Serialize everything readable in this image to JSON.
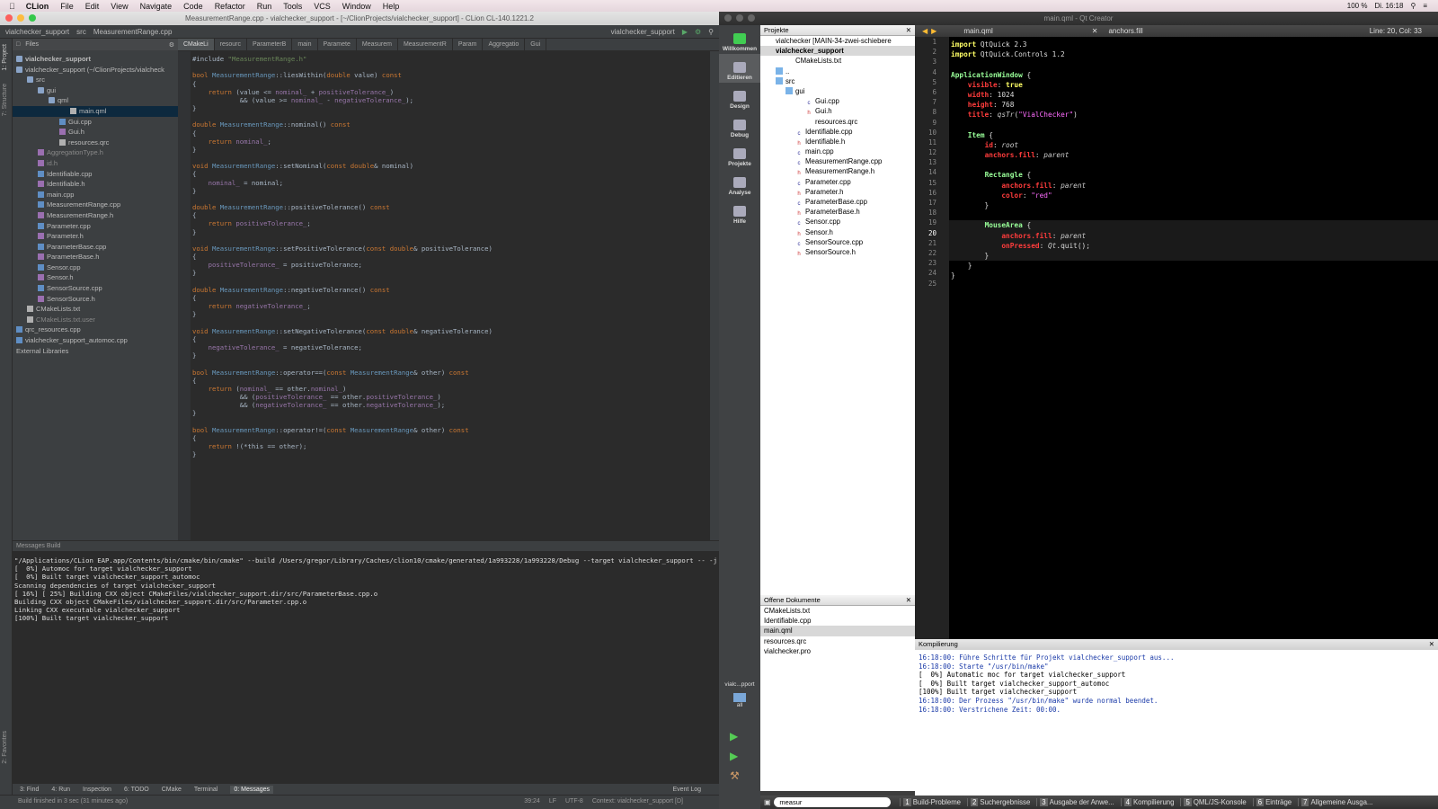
{
  "menubar": {
    "app_name": "CLion",
    "items": [
      "File",
      "Edit",
      "View",
      "Navigate",
      "Code",
      "Refactor",
      "Run",
      "Tools",
      "VCS",
      "Window",
      "Help"
    ],
    "battery": "100 %",
    "clock": "Di. 16:18"
  },
  "clion": {
    "window_title": "MeasurementRange.cpp - vialchecker_support - [~/ClionProjects/vialchecker_support] - CLion CL-140.1221.2",
    "breadcrumb": [
      "vialchecker_support",
      "src",
      "MeasurementRange.cpp"
    ],
    "run_config": "vialchecker_support",
    "project_tab": "Files",
    "tree": [
      {
        "label": "vialchecker_support",
        "indent": 0,
        "kind": "root"
      },
      {
        "label": "vialchecker_support (~/ClionProjects/vialcheck",
        "indent": 0,
        "kind": "folder"
      },
      {
        "label": "src",
        "indent": 1,
        "kind": "folder"
      },
      {
        "label": "gui",
        "indent": 2,
        "kind": "folder"
      },
      {
        "label": "qml",
        "indent": 3,
        "kind": "folder"
      },
      {
        "label": "main.qml",
        "indent": 5,
        "kind": "file",
        "selected": true
      },
      {
        "label": "Gui.cpp",
        "indent": 4,
        "kind": "cpp"
      },
      {
        "label": "Gui.h",
        "indent": 4,
        "kind": "h"
      },
      {
        "label": "resources.qrc",
        "indent": 4,
        "kind": "file"
      },
      {
        "label": "AggregationType.h",
        "indent": 2,
        "kind": "h",
        "dim": true
      },
      {
        "label": "id.h",
        "indent": 2,
        "kind": "h",
        "dim": true
      },
      {
        "label": "Identifiable.cpp",
        "indent": 2,
        "kind": "cpp"
      },
      {
        "label": "Identifiable.h",
        "indent": 2,
        "kind": "h"
      },
      {
        "label": "main.cpp",
        "indent": 2,
        "kind": "cpp"
      },
      {
        "label": "MeasurementRange.cpp",
        "indent": 2,
        "kind": "cpp"
      },
      {
        "label": "MeasurementRange.h",
        "indent": 2,
        "kind": "h"
      },
      {
        "label": "Parameter.cpp",
        "indent": 2,
        "kind": "cpp"
      },
      {
        "label": "Parameter.h",
        "indent": 2,
        "kind": "h"
      },
      {
        "label": "ParameterBase.cpp",
        "indent": 2,
        "kind": "cpp"
      },
      {
        "label": "ParameterBase.h",
        "indent": 2,
        "kind": "h"
      },
      {
        "label": "Sensor.cpp",
        "indent": 2,
        "kind": "cpp"
      },
      {
        "label": "Sensor.h",
        "indent": 2,
        "kind": "h"
      },
      {
        "label": "SensorSource.cpp",
        "indent": 2,
        "kind": "cpp"
      },
      {
        "label": "SensorSource.h",
        "indent": 2,
        "kind": "h"
      },
      {
        "label": "CMakeLists.txt",
        "indent": 1,
        "kind": "txt"
      },
      {
        "label": "CMakeLists.txt.user",
        "indent": 1,
        "kind": "txt",
        "dim": true
      },
      {
        "label": "qrc_resources.cpp",
        "indent": 0,
        "kind": "cpp"
      },
      {
        "label": "vialchecker_support_automoc.cpp",
        "indent": 0,
        "kind": "cpp"
      },
      {
        "label": "External Libraries",
        "indent": 0,
        "kind": "plain"
      }
    ],
    "tabs": [
      "CMakeLi",
      "resourc",
      "ParameterB",
      "main",
      "Paramete",
      "Measurem",
      "MeasurementR",
      "Param",
      "Aggregatio",
      "Gui"
    ],
    "active_tab": 0,
    "code": [
      "#include \"MeasurementRange.h\"",
      "",
      "bool MeasurementRange::liesWithin(double value) const",
      "{",
      "    return (value <= nominal_ + positiveTolerance_)",
      "            && (value >= nominal_ - negativeTolerance_);",
      "}",
      "",
      "double MeasurementRange::nominal() const",
      "{",
      "    return nominal_;",
      "}",
      "",
      "void MeasurementRange::setNominal(const double& nominal)",
      "{",
      "    nominal_ = nominal;",
      "}",
      "",
      "double MeasurementRange::positiveTolerance() const",
      "{",
      "    return positiveTolerance_;",
      "}",
      "",
      "void MeasurementRange::setPositiveTolerance(const double& positiveTolerance)",
      "{",
      "    positiveTolerance_ = positiveTolerance;",
      "}",
      "",
      "double MeasurementRange::negativeTolerance() const",
      "{",
      "    return negativeTolerance_;",
      "}",
      "",
      "void MeasurementRange::setNegativeTolerance(const double& negativeTolerance)",
      "{",
      "    negativeTolerance_ = negativeTolerance;",
      "}",
      "",
      "bool MeasurementRange::operator==(const MeasurementRange& other) const",
      "{",
      "    return (nominal_ == other.nominal_)",
      "            && (positiveTolerance_ == other.positiveTolerance_)",
      "            && (negativeTolerance_ == other.negativeTolerance_);",
      "}",
      "",
      "bool MeasurementRange::operator!=(const MeasurementRange& other) const",
      "{",
      "    return !(*this == other);",
      "}"
    ],
    "messages_title": "Messages Build",
    "messages": [
      "\"/Applications/CLion EAP.app/Contents/bin/cmake/bin/cmake\" --build /Users/gregor/Library/Caches/clion10/cmake/generated/1a993228/1a993228/Debug --target vialchecker_support -- -j 4",
      "[  0%] Automoc for target vialchecker_support",
      "[  0%] Built target vialchecker_support_automoc",
      "Scanning dependencies of target vialchecker_support",
      "[ 16%] [ 25%] Building CXX object CMakeFiles/vialchecker_support.dir/src/ParameterBase.cpp.o",
      "Building CXX object CMakeFiles/vialchecker_support.dir/src/Parameter.cpp.o",
      "Linking CXX executable vialchecker_support",
      "[100%] Built target vialchecker_support"
    ],
    "bottom_tools": [
      "3: Find",
      "4: Run",
      "Inspection",
      "6: TODO",
      "CMake",
      "Terminal",
      "0: Messages"
    ],
    "event_log": "Event Log",
    "status_text": "Build finished in 3 sec (31 minutes ago)",
    "status_right": [
      "39:24",
      "LF",
      "UTF-8",
      "Context: vialchecker_support [D]"
    ],
    "left_tools": [
      "1: Project",
      "7: Structure",
      "2: Favorites"
    ]
  },
  "qt": {
    "window_title": "main.qml - Qt Creator",
    "modes": [
      "Willkommen",
      "Editieren",
      "Design",
      "Debug",
      "Projekte",
      "Analyse",
      "Hilfe"
    ],
    "active_mode": 1,
    "projects_title": "Projekte",
    "project_tree": [
      {
        "label": "vialchecker [MAIN-34-zwei-schiebere",
        "indent": 0,
        "kind": "pro"
      },
      {
        "label": "vialchecker_support",
        "indent": 0,
        "kind": "pro",
        "selected": true
      },
      {
        "label": "CMakeLists.txt",
        "indent": 2,
        "kind": "txt"
      },
      {
        "label": "..",
        "indent": 1,
        "kind": "folder"
      },
      {
        "label": "src",
        "indent": 1,
        "kind": "folder"
      },
      {
        "label": "gui",
        "indent": 2,
        "kind": "folder"
      },
      {
        "label": "Gui.cpp",
        "indent": 4,
        "kind": "cpp"
      },
      {
        "label": "Gui.h",
        "indent": 4,
        "kind": "h"
      },
      {
        "label": "resources.qrc",
        "indent": 4,
        "kind": "qrc"
      },
      {
        "label": "Identifiable.cpp",
        "indent": 3,
        "kind": "cpp"
      },
      {
        "label": "Identifiable.h",
        "indent": 3,
        "kind": "h"
      },
      {
        "label": "main.cpp",
        "indent": 3,
        "kind": "cpp"
      },
      {
        "label": "MeasurementRange.cpp",
        "indent": 3,
        "kind": "cpp"
      },
      {
        "label": "MeasurementRange.h",
        "indent": 3,
        "kind": "h"
      },
      {
        "label": "Parameter.cpp",
        "indent": 3,
        "kind": "cpp"
      },
      {
        "label": "Parameter.h",
        "indent": 3,
        "kind": "h"
      },
      {
        "label": "ParameterBase.cpp",
        "indent": 3,
        "kind": "cpp"
      },
      {
        "label": "ParameterBase.h",
        "indent": 3,
        "kind": "h"
      },
      {
        "label": "Sensor.cpp",
        "indent": 3,
        "kind": "cpp"
      },
      {
        "label": "Sensor.h",
        "indent": 3,
        "kind": "h"
      },
      {
        "label": "SensorSource.cpp",
        "indent": 3,
        "kind": "cpp"
      },
      {
        "label": "SensorSource.h",
        "indent": 3,
        "kind": "h"
      }
    ],
    "open_docs_title": "Offene Dokumente",
    "open_docs": [
      "CMakeLists.txt",
      "Identifiable.cpp",
      "main.qml",
      "resources.qrc",
      "vialchecker.pro"
    ],
    "open_docs_selected": 2,
    "editor_file": "main.qml",
    "editor_symbol": "anchors.fill",
    "cursor_pos": "Line: 20, Col: 33",
    "build_target": "vialc...pport",
    "build_target_sub": "all",
    "qml": [
      "import QtQuick 2.3",
      "import QtQuick.Controls 1.2",
      "",
      "ApplicationWindow {",
      "    visible: true",
      "    width: 1024",
      "    height: 768",
      "    title: qsTr(\"VialChecker\")",
      "",
      "    Item {",
      "        id: root",
      "        anchors.fill: parent",
      "",
      "        Rectangle {",
      "            anchors.fill: parent",
      "            color: \"red\"",
      "        }",
      "",
      "        MouseArea {",
      "            anchors.fill: parent",
      "            onPressed: Qt.quit();",
      "        }",
      "    }",
      "}",
      ""
    ],
    "compile_title": "Kompilierung",
    "compile_output": [
      {
        "t": "16:18:00: Führe Schritte für Projekt vialchecker_support aus...",
        "c": "blue"
      },
      {
        "t": "16:18:00: Starte \"/usr/bin/make\"",
        "c": "blue"
      },
      {
        "t": "[  0%] Automatic moc for target vialchecker_support",
        "c": "blk"
      },
      {
        "t": "[  0%] Built target vialchecker_support_automoc",
        "c": "blk"
      },
      {
        "t": "[100%] Built target vialchecker_support",
        "c": "blk"
      },
      {
        "t": "16:18:00: Der Prozess \"/usr/bin/make\" wurde normal beendet.",
        "c": "blue"
      },
      {
        "t": "16:18:00: Verstrichene Zeit: 00:00.",
        "c": "blue"
      }
    ],
    "search_placeholder": "measur",
    "output_panes": [
      {
        "n": "1",
        "label": "Build-Probleme"
      },
      {
        "n": "2",
        "label": "Suchergebnisse"
      },
      {
        "n": "3",
        "label": "Ausgabe der Anwe..."
      },
      {
        "n": "4",
        "label": "Kompilierung"
      },
      {
        "n": "5",
        "label": "QML/JS-Konsole"
      },
      {
        "n": "6",
        "label": "Einträge"
      },
      {
        "n": "7",
        "label": "Allgemeine Ausga..."
      }
    ]
  },
  "colors": {
    "clion_bg": "#2b2b2b",
    "qt_editor_bg": "#000000",
    "accent": "#0d293e"
  }
}
